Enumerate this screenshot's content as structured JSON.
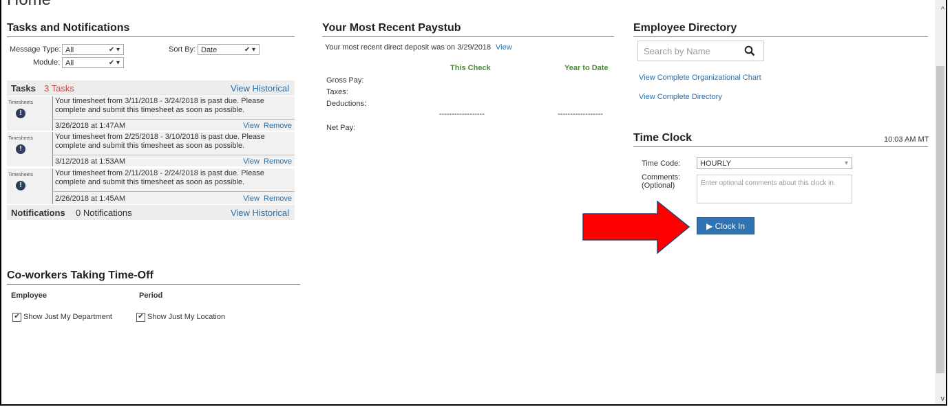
{
  "page": {
    "title": "Home"
  },
  "tasks": {
    "title": "Tasks and Notifications",
    "message_type_label": "Message Type:",
    "message_type_value": "All",
    "module_label": "Module:",
    "module_value": "All",
    "sort_by_label": "Sort By:",
    "sort_by_value": "Date",
    "tasks_label": "Tasks",
    "tasks_count": "3 Tasks",
    "view_historical": "View Historical",
    "items": [
      {
        "category": "Timesheets",
        "message": "Your timesheet from 3/11/2018 - 3/24/2018 is past due. Please complete and submit this timesheet as soon as possible.",
        "date": "3/26/2018 at 1:47AM",
        "view": "View",
        "remove": "Remove"
      },
      {
        "category": "Timesheets",
        "message": "Your timesheet from 2/25/2018 - 3/10/2018 is past due. Please complete and submit this timesheet as soon as possible.",
        "date": "3/12/2018 at 1:53AM",
        "view": "View",
        "remove": "Remove"
      },
      {
        "category": "Timesheets",
        "message": "Your timesheet from 2/11/2018 - 2/24/2018 is past due. Please complete and submit this timesheet as soon as possible.",
        "date": "2/26/2018 at 1:45AM",
        "view": "View",
        "remove": "Remove"
      }
    ],
    "notifications_label": "Notifications",
    "notifications_count": "0 Notifications",
    "notifications_view_historical": "View Historical"
  },
  "coworkers": {
    "title": "Co-workers Taking Time-Off",
    "col_employee": "Employee",
    "col_period": "Period",
    "show_department": "Show Just My Department",
    "show_location": "Show Just My Location"
  },
  "paystub": {
    "title": "Your Most Recent Paystub",
    "deposit_text": "Your most recent direct deposit was on 3/29/2018",
    "view_link": "View",
    "col_this_check": "This Check",
    "col_year_to_date": "Year to Date",
    "gross_pay": "Gross Pay:",
    "taxes": "Taxes:",
    "deductions": "Deductions:",
    "net_pay": "Net Pay:",
    "dashes": "------------------"
  },
  "directory": {
    "title": "Employee Directory",
    "search_placeholder": "Search by Name",
    "org_chart_link": "View Complete Organizational Chart",
    "directory_link": "View Complete Directory"
  },
  "timeclock": {
    "title": "Time Clock",
    "time": "10:03 AM MT",
    "time_code_label": "Time Code:",
    "time_code_value": "HOURLY",
    "comments_label": "Comments:",
    "comments_optional": "(Optional)",
    "comments_placeholder": "Enter optional comments about this clock in.",
    "clock_in_button": "Clock In"
  },
  "colors": {
    "accent_link": "#2a6ea6",
    "button": "#2f73b3",
    "arrow": "#ff0000",
    "task_count": "#c0504d",
    "paystub_header": "#4a8a3a"
  }
}
